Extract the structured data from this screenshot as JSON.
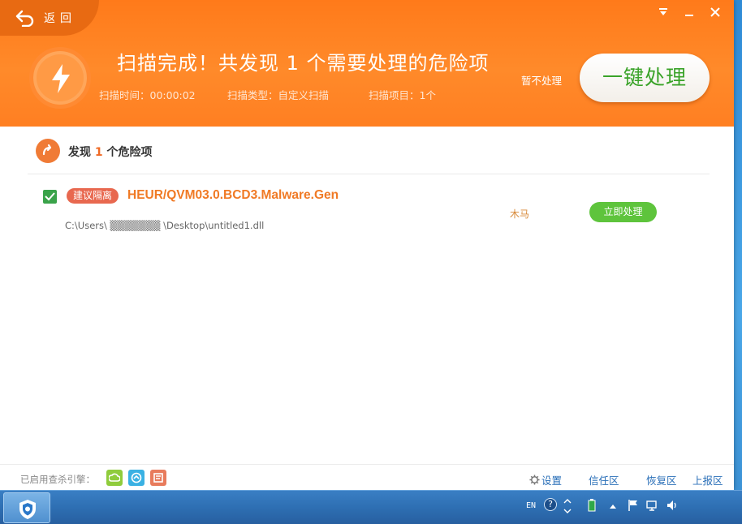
{
  "header": {
    "back_label": "返回",
    "title": "扫描完成！共发现 1 个需要处理的危险项",
    "scan_time": "扫描时间：00:00:02",
    "scan_type": "扫描类型：自定义扫描",
    "scan_items": "扫描项目：1个",
    "skip_label": "暂不处理",
    "one_click_label": "一键处理",
    "window_controls": [
      "menu-icon",
      "minimize-icon",
      "close-icon"
    ]
  },
  "results": {
    "heading_prefix": "发现",
    "heading_count": "1",
    "heading_suffix": "个危险项",
    "items": [
      {
        "badge": "建议隔离",
        "name": "HEUR/QVM03.0.BCD3.Malware.Gen",
        "path": "C:\\Users\\  ▒▒▒▒▒▒▒  \\Desktop\\untitled1.dll",
        "type": "木马",
        "action": "立即处理",
        "checked": true
      }
    ]
  },
  "footer": {
    "engines_label": "已启用查杀引擎：",
    "engines": [
      "cloud-engine-icon",
      "qvm-engine-icon",
      "kill-engine-icon"
    ],
    "settings": "设置",
    "trust_zone": "信任区",
    "restore_zone": "恢复区",
    "report_zone": "上报区"
  },
  "taskbar": {
    "language": "EN",
    "help": "?"
  },
  "colors": {
    "header_orange": "#ff7f22",
    "accent_green": "#5ec43c",
    "threat_orange": "#f07a25",
    "badge_red": "#e8684f",
    "link_blue": "#2a6fb8"
  }
}
